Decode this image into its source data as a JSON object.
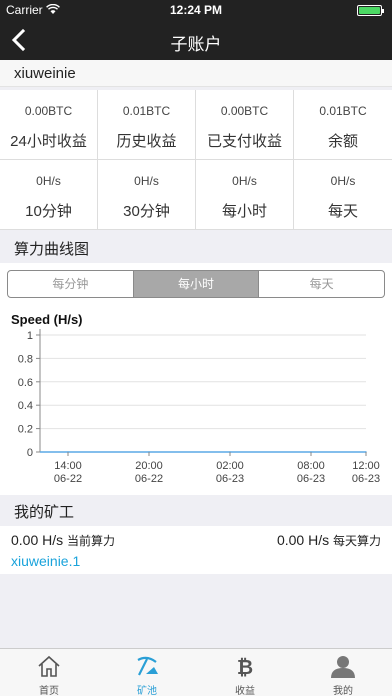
{
  "status_bar": {
    "carrier": "Carrier",
    "time": "12:24 PM"
  },
  "nav": {
    "title": "子账户",
    "back_icon": "chevron-left-icon"
  },
  "account_name": "xiuweinie",
  "stats": [
    {
      "value": "0.00BTC",
      "label": "24小时收益"
    },
    {
      "value": "0.01BTC",
      "label": "历史收益"
    },
    {
      "value": "0.00BTC",
      "label": "已支付收益"
    },
    {
      "value": "0.01BTC",
      "label": "余额"
    },
    {
      "value": "0H/s",
      "label": "10分钟"
    },
    {
      "value": "0H/s",
      "label": "30分钟"
    },
    {
      "value": "0H/s",
      "label": "每小时"
    },
    {
      "value": "0H/s",
      "label": "每天"
    }
  ],
  "chart_section": {
    "title": "算力曲线图",
    "tabs": [
      "每分钟",
      "每小时",
      "每天"
    ],
    "active_tab": 1
  },
  "chart_data": {
    "type": "line",
    "title": "Speed (H/s)",
    "xlabel": "",
    "ylabel": "",
    "ylim": [
      0,
      1
    ],
    "yticks": [
      "1",
      "0.8",
      "0.6",
      "0.4",
      "0.2",
      "0"
    ],
    "xticks": [
      {
        "time": "14:00",
        "date": "06-22"
      },
      {
        "time": "20:00",
        "date": "06-22"
      },
      {
        "time": "02:00",
        "date": "06-23"
      },
      {
        "time": "08:00",
        "date": "06-23"
      },
      {
        "time": "12:00",
        "date": "06-23"
      }
    ],
    "x": [
      "06-22 14:00",
      "06-22 20:00",
      "06-23 02:00",
      "06-23 08:00",
      "06-23 12:00"
    ],
    "series": [
      {
        "values": [
          0,
          0,
          0,
          0,
          0
        ],
        "color": "#5aa9e6"
      }
    ],
    "grid": true
  },
  "miner_section": {
    "title": "我的矿工",
    "current_value": "0.00 H/s",
    "current_label": "当前算力",
    "daily_value": "0.00 H/s",
    "daily_label": "每天算力",
    "worker_name": "xiuweinie.1"
  },
  "tabbar": [
    {
      "label": "首页",
      "icon": "home-icon"
    },
    {
      "label": "矿池",
      "icon": "pickaxe-icon"
    },
    {
      "label": "收益",
      "icon": "bitcoin-icon"
    },
    {
      "label": "我的",
      "icon": "user-icon"
    }
  ],
  "active_tab": 1,
  "colors": {
    "accent": "#2a9fd6",
    "header": "#222222",
    "link": "#1aa3db"
  }
}
